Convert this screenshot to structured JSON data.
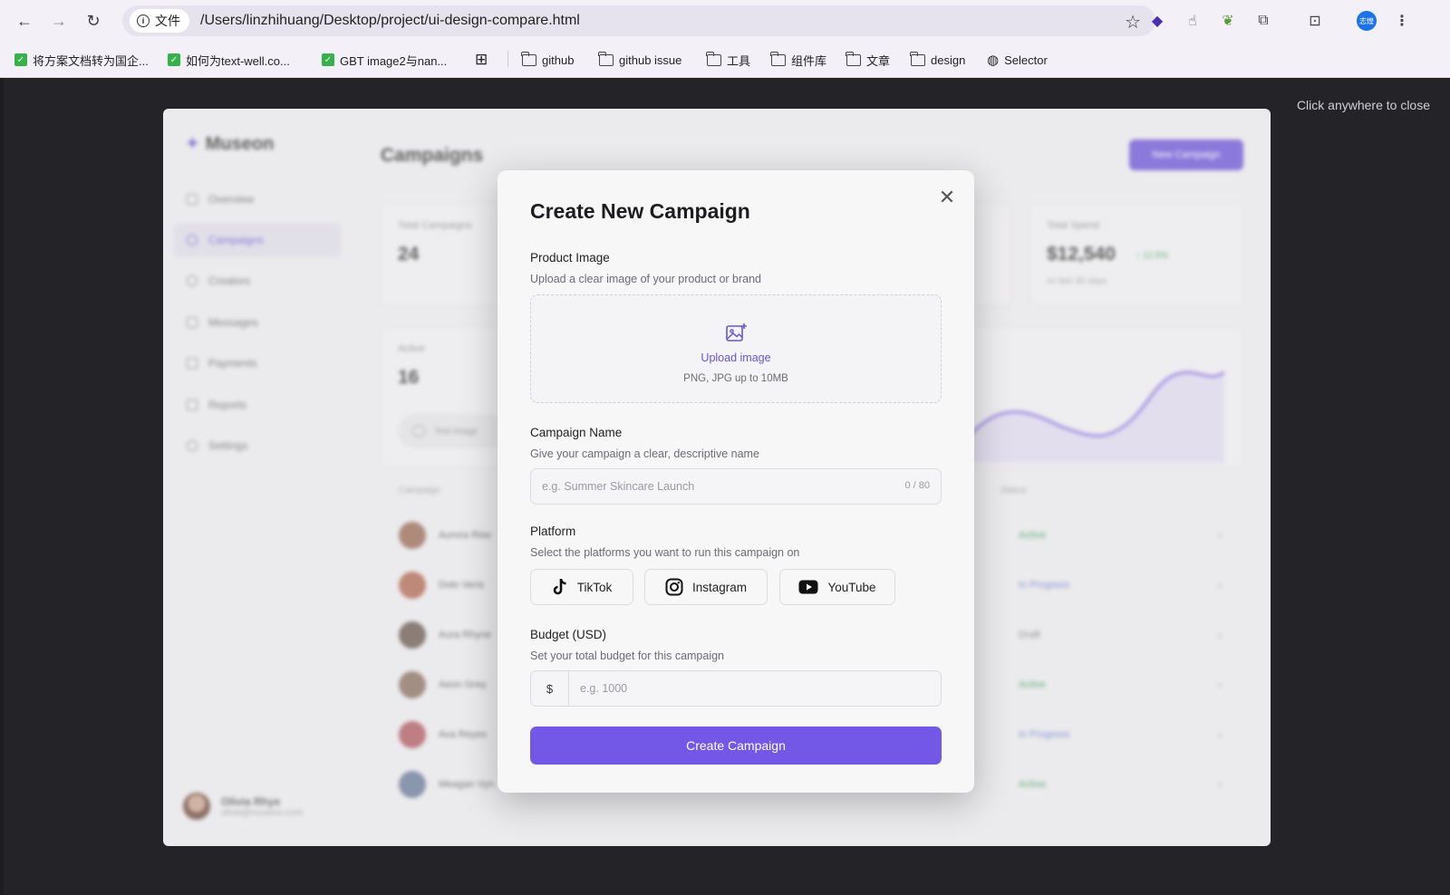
{
  "browser": {
    "site_info_label": "文件",
    "url": "/Users/linzhihuang/Desktop/project/ui-design-compare.html",
    "profile_badge": "志煌",
    "bookmarks": [
      {
        "label": "将方案文档转为国企...",
        "type": "check"
      },
      {
        "label": "如何为text-well.co...",
        "type": "check"
      },
      {
        "label": "GBT image2与nan...",
        "type": "check"
      },
      {
        "label": "",
        "type": "apps"
      },
      {
        "label": "github",
        "type": "folder"
      },
      {
        "label": "github issue",
        "type": "folder"
      },
      {
        "label": "工具",
        "type": "folder"
      },
      {
        "label": "组件库",
        "type": "folder"
      },
      {
        "label": "文章",
        "type": "folder"
      },
      {
        "label": "design",
        "type": "folder"
      },
      {
        "label": "Selector",
        "type": "globe"
      }
    ]
  },
  "overlay": {
    "close_hint": "Click anywhere to close"
  },
  "background_app": {
    "brand": "Museon",
    "page_title": "Campaigns",
    "new_button": "New Campaign",
    "nav": [
      "Overview",
      "Campaigns",
      "Creators",
      "Messages",
      "Payments",
      "Reports",
      "Settings"
    ],
    "active_nav": "Campaigns",
    "stats": [
      {
        "label": "Total Campaigns",
        "value": "24"
      },
      {
        "label": "Total Spend",
        "value": "$12,540",
        "delta": "↑ 12.5%",
        "sub": "vs last 30 days"
      }
    ],
    "active_card": {
      "label": "Active",
      "value": "16",
      "chip": "Test image"
    },
    "table_headers": {
      "campaign": "Campaign",
      "status": "Status"
    },
    "rows": [
      {
        "name": "Aurora Rise",
        "status": "Active"
      },
      {
        "name": "Dolo Veris",
        "status": "In Progress"
      },
      {
        "name": "Aura Rhyne",
        "status": "Draft"
      },
      {
        "name": "Aeon Grey",
        "status": "Active"
      },
      {
        "name": "Ava Reyes",
        "status": "In Progress"
      },
      {
        "name": "Meagan Vyn",
        "status": "Active"
      }
    ],
    "profile": {
      "name": "Olivia Rhye",
      "email": "olivia@museon.com"
    }
  },
  "modal": {
    "title": "Create New Campaign",
    "product_image": {
      "label": "Product Image",
      "help": "Upload a clear image of your product or brand",
      "upload_text": "Upload image",
      "upload_hint": "PNG, JPG up to 10MB"
    },
    "campaign_name": {
      "label": "Campaign Name",
      "help": "Give your campaign a clear, descriptive name",
      "placeholder": "e.g. Summer Skincare Launch",
      "value": "",
      "counter": "0 / 80"
    },
    "platform": {
      "label": "Platform",
      "help": "Select the platforms you want to run this campaign on",
      "options": [
        "TikTok",
        "Instagram",
        "YouTube"
      ]
    },
    "budget": {
      "label": "Budget (USD)",
      "help": "Set your total budget for this campaign",
      "prefix": "$",
      "placeholder": "e.g. 1000",
      "value": ""
    },
    "submit_label": "Create Campaign"
  },
  "colors": {
    "accent": "#7357e6",
    "page_bg": "#242428",
    "modal_bg": "#f7f7f8",
    "chrome_bg": "#f3f0f8"
  }
}
